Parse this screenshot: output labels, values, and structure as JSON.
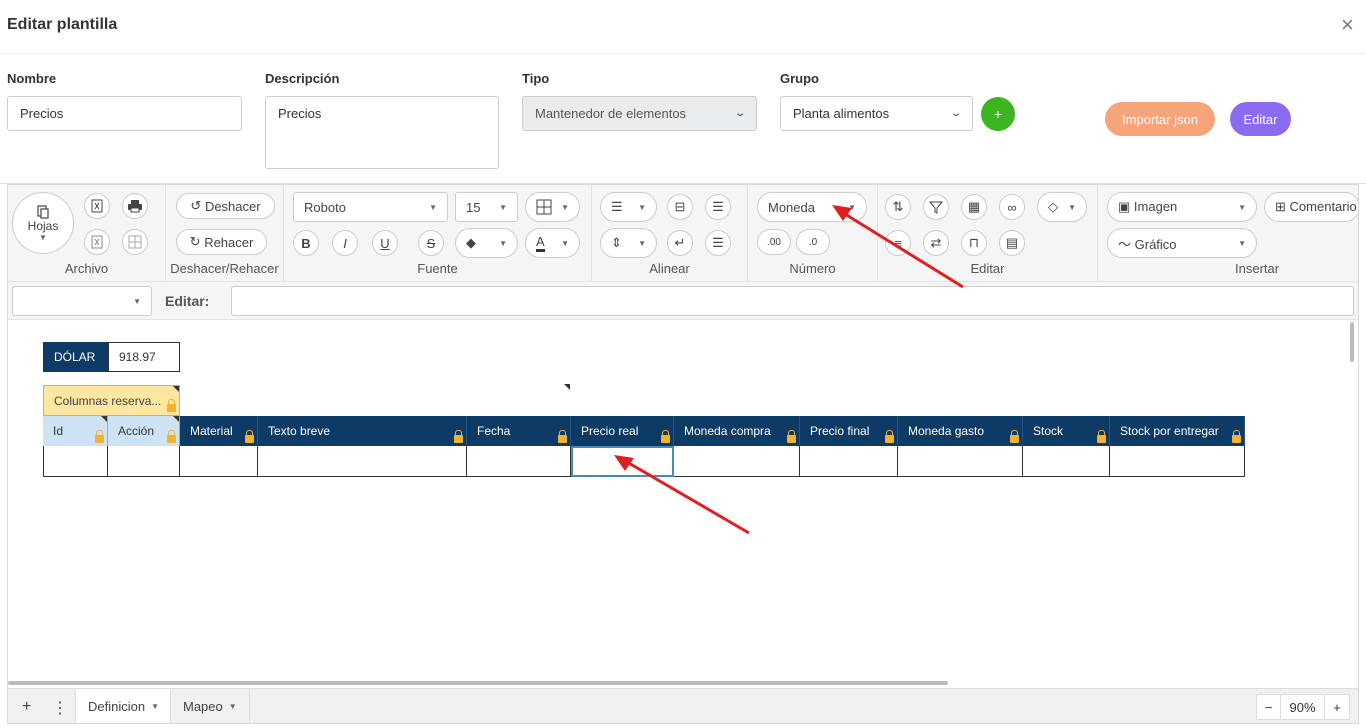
{
  "modal": {
    "title": "Editar plantilla",
    "close": "×"
  },
  "form": {
    "nombre_label": "Nombre",
    "nombre_value": "Precios",
    "descripcion_label": "Descripción",
    "descripcion_value": "Precios",
    "tipo_label": "Tipo",
    "tipo_value": "Mantenedor de elementos",
    "grupo_label": "Grupo",
    "grupo_value": "Planta alimentos",
    "add_label": "+",
    "importar_label": "Importar json",
    "editar_label": "Editar"
  },
  "ribbon": {
    "hojas": "Hojas",
    "groups": [
      "Archivo",
      "Deshacer/Rehacer",
      "Fuente",
      "Alinear",
      "Número",
      "Editar",
      "Insertar"
    ],
    "deshacer": "Deshacer",
    "rehacer": "Rehacer",
    "font": "Roboto",
    "size": "15",
    "bold": "B",
    "italic": "I",
    "underline": "U",
    "strike": "S",
    "font_color": "A",
    "number_format": "Moneda",
    "imagen": "Imagen",
    "grafico": "Gráfico",
    "comentario": "Comentario"
  },
  "formula": {
    "label": "Editar:",
    "value": ""
  },
  "sheet": {
    "dolar_label": "DÓLAR",
    "dolar_value": "918.97",
    "reserved_label": "Columnas reserva...",
    "columns": [
      "Id",
      "Acción",
      "Material",
      "Texto breve",
      "Fecha",
      "Precio real",
      "Moneda compra",
      "Precio final",
      "Moneda gasto",
      "Stock",
      "Stock por entregar"
    ]
  },
  "tabs": {
    "items": [
      "Definicion",
      "Mapeo"
    ],
    "add": "+",
    "menu": "⋮",
    "zoom_minus": "−",
    "zoom_value": "90%",
    "zoom_plus": "+"
  },
  "colors": {
    "header": "#0d3b66",
    "accent_green": "#3cb521",
    "import_btn": "#f6a57a",
    "edit_btn": "#8b6cf0",
    "arrow": "#e02020"
  }
}
